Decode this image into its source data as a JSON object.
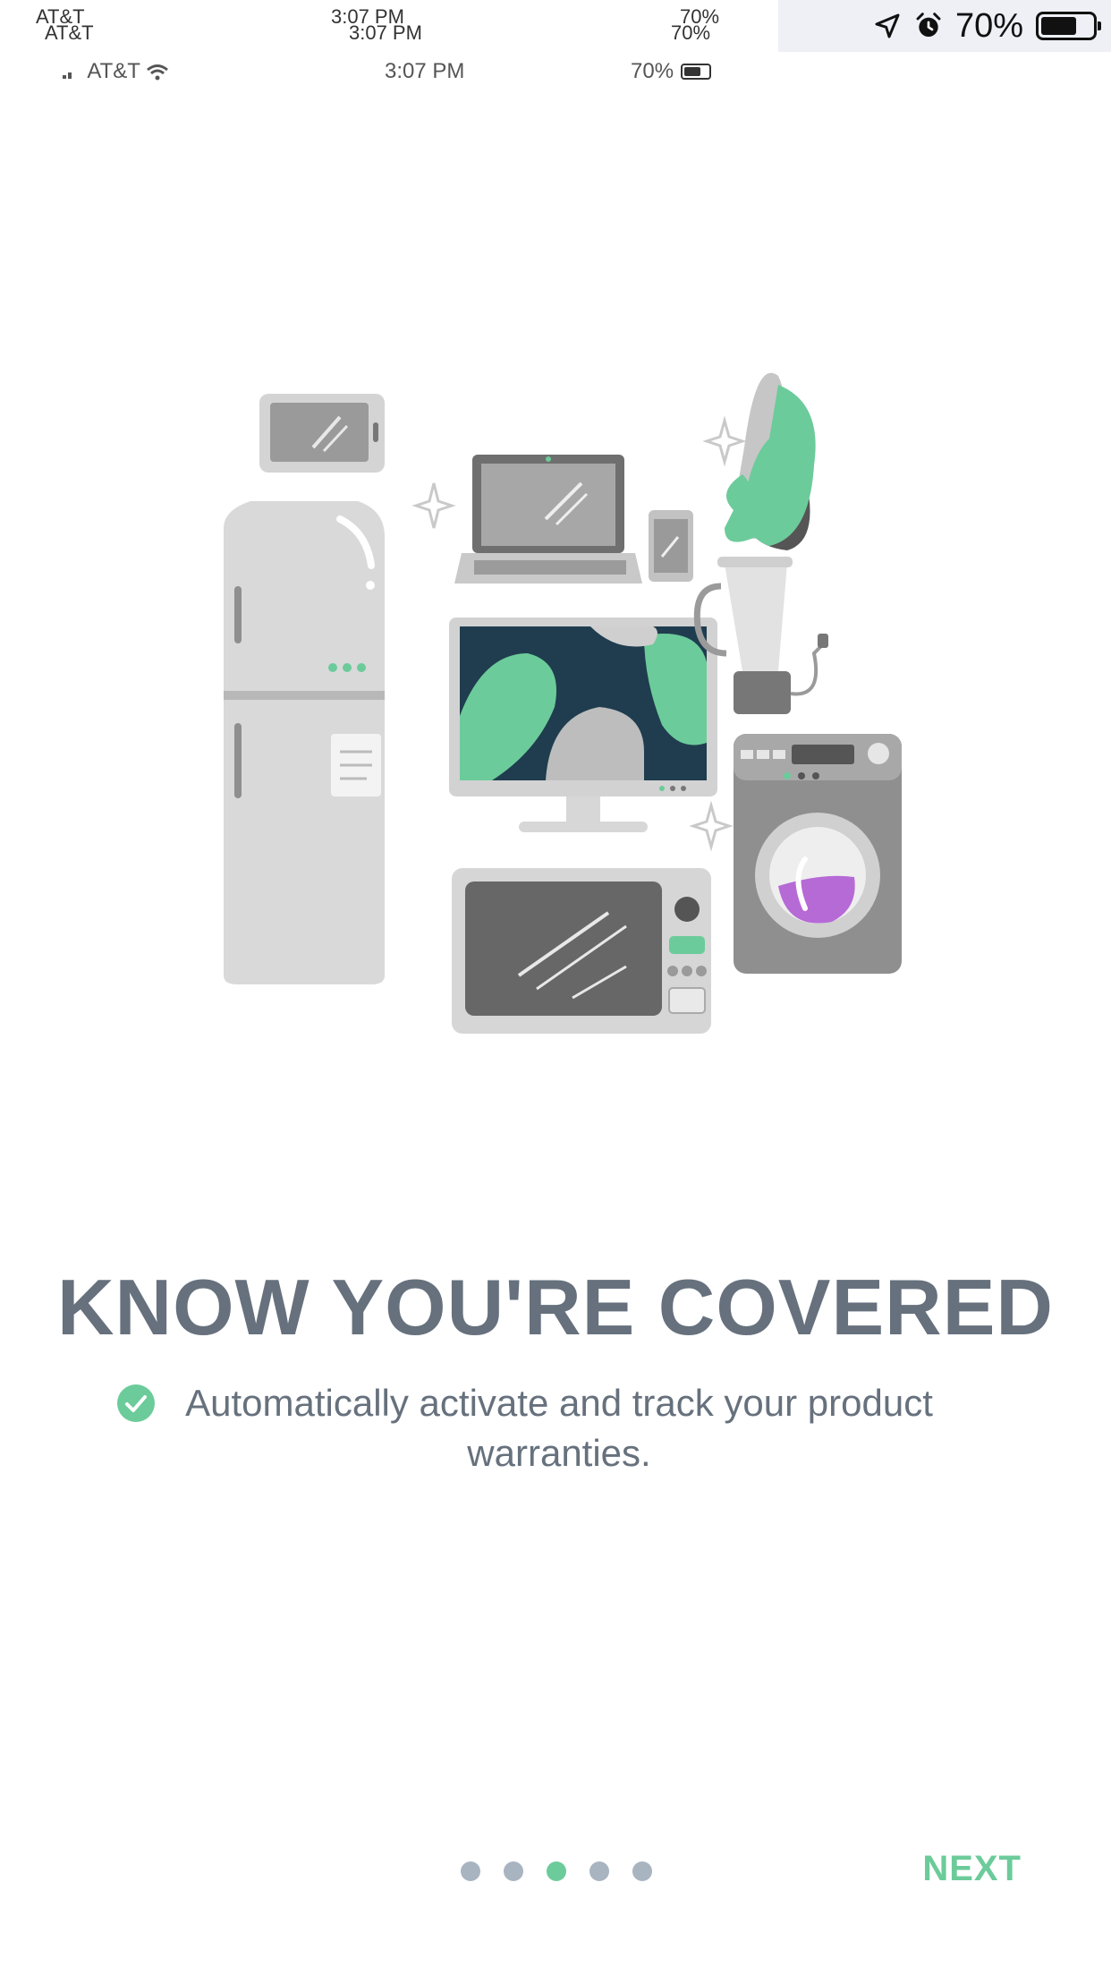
{
  "status_bar": {
    "carrier": "AT&T",
    "time": "3:07 PM",
    "battery": "70%",
    "battery_level": 0.7,
    "icons": [
      "location-icon",
      "alarm-icon",
      "wifi-icon",
      "battery-icon"
    ]
  },
  "onboarding": {
    "title": "KNOW YOU'RE COVERED",
    "feature_text": "Automatically activate and track your product warranties.",
    "feature_icon": "check-circle-icon",
    "illustration": "appliances-illustration",
    "page_count": 5,
    "active_page": 3,
    "next_label": "NEXT"
  },
  "colors": {
    "accent": "#6ccb9a",
    "text": "#66717d",
    "dot_inactive": "#a8b4c0",
    "purple": "#b66ad6",
    "dark_teal": "#1f3d4f"
  }
}
